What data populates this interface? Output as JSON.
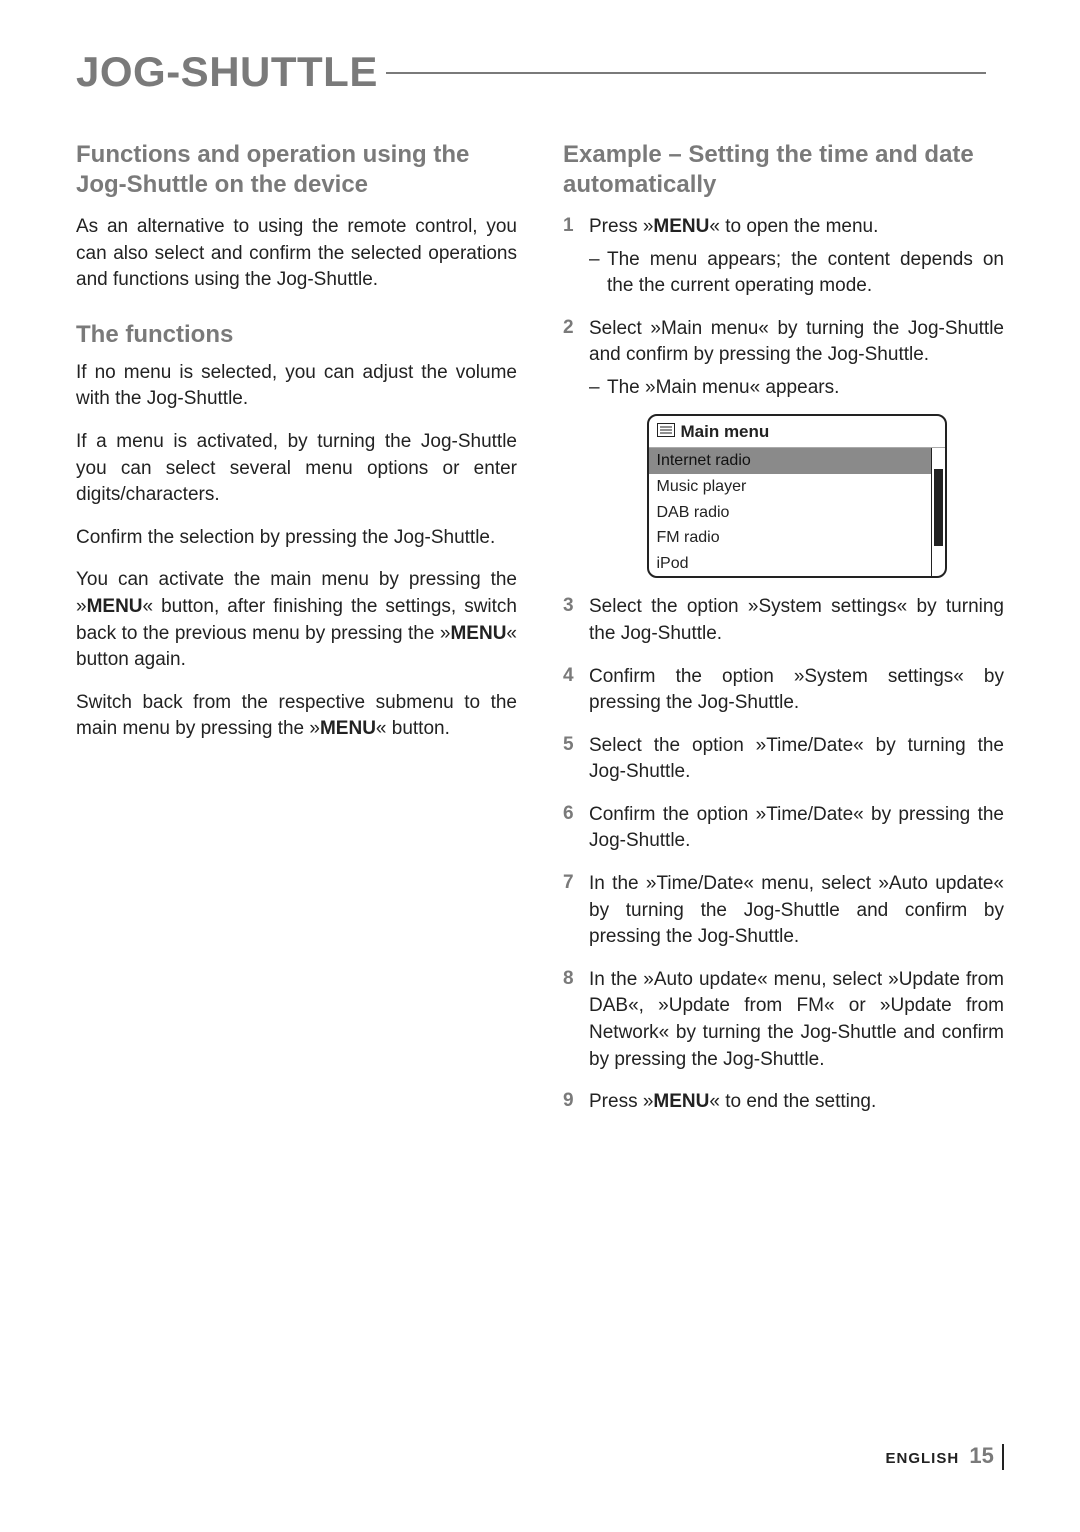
{
  "title": "JOG-SHUTTLE",
  "left": {
    "heading": "Functions and operation using the Jog-Shuttle on the device",
    "p1": "As an alternative to using the remote control, you can also select and confirm the selected operations and functions using the Jog-Shuttle.",
    "subheading": "The functions",
    "p2": "If no menu is selected, you can adjust the volume with the Jog-Shuttle.",
    "p3": "If a menu is activated, by turning the Jog-Shuttle you can select several menu options or enter digits/characters.",
    "p4": "Confirm the selection by pressing the Jog-Shuttle.",
    "p5a": "You can activate the main menu by pressing the »",
    "p5btn1": "MENU",
    "p5b": "« button, after finishing the settings, switch back to the previous menu by pressing the »",
    "p5btn2": "MENU",
    "p5c": "« button again.",
    "p6a": "Switch back from the respective submenu to the main menu by pressing the »",
    "p6btn": "MENU",
    "p6b": "« button."
  },
  "right": {
    "heading": "Example – Setting the time and date automatically",
    "steps": [
      {
        "num": "1",
        "a": "Press »",
        "btn": "MENU",
        "b": "« to open the menu.",
        "dash": "The menu appears; the content depends on the the current operating mode."
      },
      {
        "num": "2",
        "a": "Select »Main menu« by turning the Jog-Shuttle and confirm by pressing the Jog-Shuttle.",
        "dash": "The »Main menu« appears."
      },
      {
        "num": "3",
        "a": "Select the option »System settings« by turning the Jog-Shuttle."
      },
      {
        "num": "4",
        "a": "Confirm the option »System settings« by pressing the Jog-Shuttle."
      },
      {
        "num": "5",
        "a": "Select the option »Time/Date« by turning the Jog-Shuttle."
      },
      {
        "num": "6",
        "a": "Confirm the option »Time/Date« by pressing the Jog-Shuttle."
      },
      {
        "num": "7",
        "a": "In the »Time/Date« menu, select »Auto update« by turning the Jog-Shuttle and confirm by pressing the Jog-Shuttle."
      },
      {
        "num": "8",
        "a": "In the »Auto update« menu, select »Update from DAB«, »Update from FM« or »Update from Network« by turning the Jog-Shuttle and confirm by pressing the Jog-Shuttle."
      },
      {
        "num": "9",
        "a": "Press »",
        "btn": "MENU",
        "b": "« to end the setting."
      }
    ]
  },
  "lcd": {
    "title": "Main menu",
    "items": [
      "Internet radio",
      "Music player",
      "DAB radio",
      "FM radio",
      "iPod"
    ],
    "selectedIndex": 0
  },
  "footer": {
    "lang": "ENGLISH",
    "page": "15"
  }
}
